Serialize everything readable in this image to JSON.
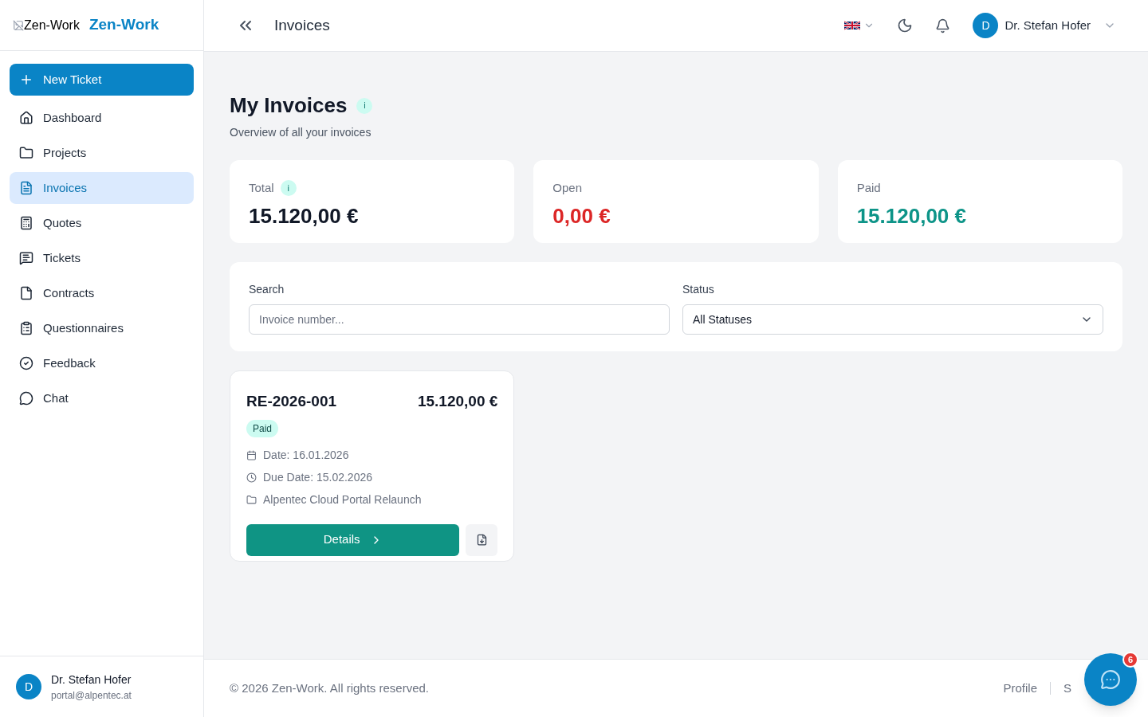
{
  "sidebar": {
    "logo_alt": "Zen-Work",
    "brand": "Zen-Work",
    "new_button": "New Ticket",
    "items": [
      {
        "label": "Dashboard",
        "selected": false
      },
      {
        "label": "Projects",
        "selected": false
      },
      {
        "label": "Invoices",
        "selected": true
      },
      {
        "label": "Quotes",
        "selected": false
      },
      {
        "label": "Tickets",
        "selected": false
      },
      {
        "label": "Contracts",
        "selected": false
      },
      {
        "label": "Questionnaires",
        "selected": false
      },
      {
        "label": "Feedback",
        "selected": false
      },
      {
        "label": "Chat",
        "selected": false
      }
    ],
    "user": {
      "initial": "D",
      "name": "Dr. Stefan Hofer",
      "email": "portal@alpentec.at"
    }
  },
  "header": {
    "title": "Invoices",
    "user": {
      "initial": "D",
      "name": "Dr. Stefan Hofer"
    }
  },
  "page": {
    "title": "My Invoices",
    "info": "i",
    "subtitle": "Overview of all your invoices"
  },
  "stats": [
    {
      "label": "Total",
      "info": "i",
      "value": "15.120,00 €",
      "color": "#111827"
    },
    {
      "label": "Open",
      "value": "0,00 €",
      "color": "#dc2626"
    },
    {
      "label": "Paid",
      "value": "15.120,00 €",
      "color": "#0d9488"
    }
  ],
  "filters": {
    "search_label": "Search",
    "search_placeholder": "Invoice number...",
    "status_label": "Status",
    "status_value": "All Statuses"
  },
  "invoices": [
    {
      "number": "RE-2026-001",
      "amount": "15.120,00 €",
      "status": "Paid",
      "date": "Date: 16.01.2026",
      "due": "Due Date: 15.02.2026",
      "project": "Alpentec Cloud Portal Relaunch",
      "details": "Details"
    }
  ],
  "footer": {
    "copyright": "© 2026 Zen-Work. All rights reserved.",
    "links": [
      "Profile",
      "S"
    ]
  },
  "chat": {
    "badge": "6"
  }
}
